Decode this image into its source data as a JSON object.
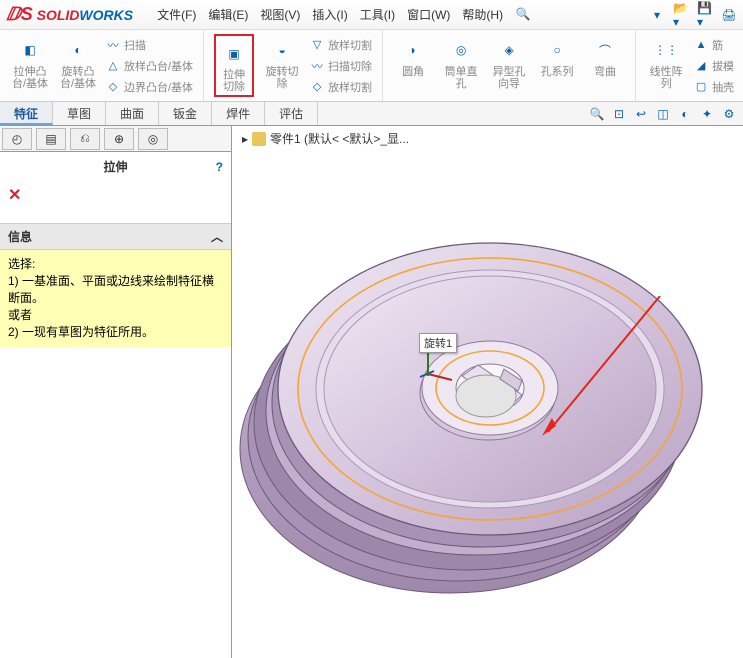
{
  "brand": {
    "prefix": "SOLID",
    "suffix": "WORKS"
  },
  "menu": {
    "file": "文件(F)",
    "edit": "编辑(E)",
    "view": "视图(V)",
    "insert": "插入(I)",
    "tools": "工具(I)",
    "window": "窗口(W)",
    "help": "帮助(H)"
  },
  "ribbon": {
    "extrude": "拉伸凸台/基体",
    "revolve": "旋转凸台/基体",
    "sweep": "扫描",
    "loft": "放样凸台/基体",
    "boundary": "边界凸台/基体",
    "cutExtrude": "拉伸切除",
    "cutRevolve": "旋转切除",
    "cutLoft": "放样切割",
    "cutSweep": "扫描切除",
    "cutBoundary": "放样切割",
    "fillet": "圆角",
    "pattern": "线性阵列",
    "rib": "筋",
    "draft": "拔模",
    "shell": "抽壳",
    "wrap": "异型孔向导",
    "hole": "孔系列",
    "flex": "弯曲",
    "holewiz": "筒单直孔"
  },
  "tabs": {
    "feature": "特征",
    "sketch": "草图",
    "surface": "曲面",
    "sheetmetal": "钣金",
    "weldment": "焊件",
    "evaluate": "评估"
  },
  "panel": {
    "title": "拉伸",
    "info": "信息",
    "select": "选择:",
    "opt1": "1) 一基准面、平面或边线来绘制特征横断面。",
    "or": "或者",
    "opt2": "2) 一现有草图为特征所用。"
  },
  "crumb": {
    "arrow": "▸",
    "part": "零件1  (默认< <默认>_显..."
  },
  "annot": {
    "text": "旋转1"
  }
}
